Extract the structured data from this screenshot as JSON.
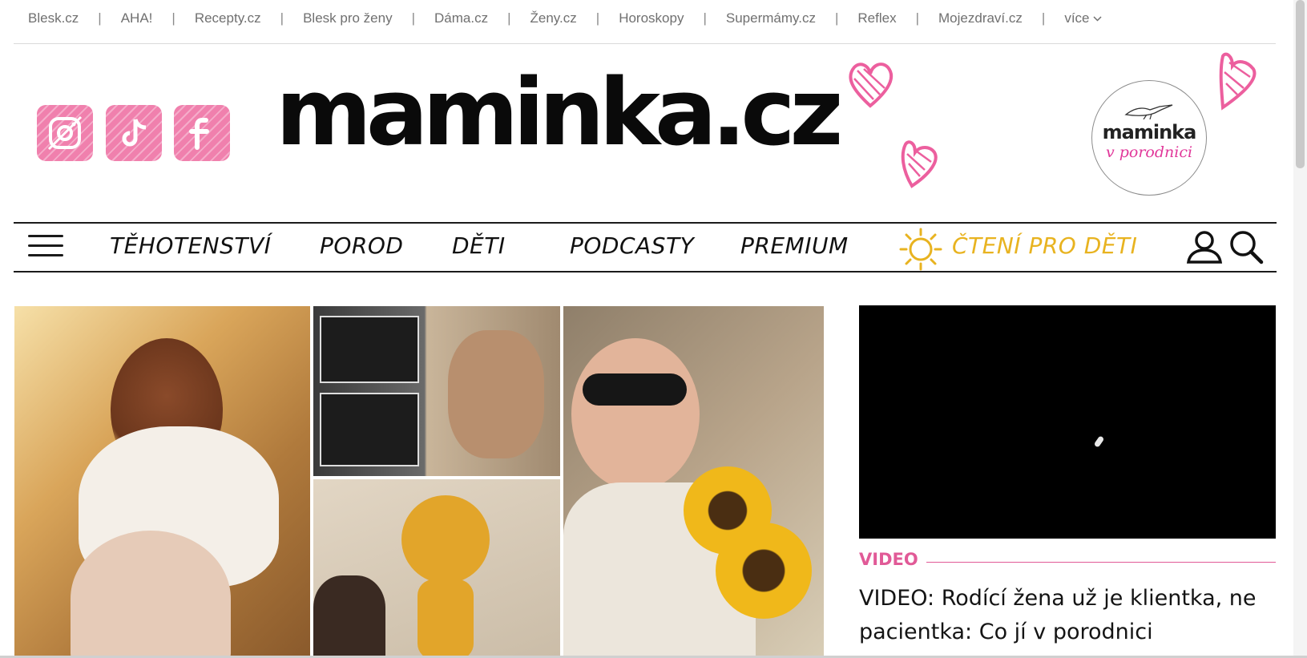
{
  "topnav": {
    "links": [
      "Blesk.cz",
      "AHA!",
      "Recepty.cz",
      "Blesk pro ženy",
      "Dáma.cz",
      "Ženy.cz",
      "Horoskopy",
      "Supermámy.cz",
      "Reflex",
      "Mojezdraví.cz"
    ],
    "more_label": "více",
    "separator": "|"
  },
  "social": [
    {
      "icon": "instagram-icon"
    },
    {
      "icon": "tiktok-icon"
    },
    {
      "icon": "facebook-icon"
    }
  ],
  "logo": {
    "text": "maminka.cz"
  },
  "badge": {
    "line1": "maminka",
    "line2": "v porodnici"
  },
  "mainnav": {
    "items": [
      "TĚHOTENSTVÍ",
      "POROD",
      "DĚTI",
      "PODCASTY",
      "PREMIUM"
    ],
    "kids_item": "ČTENÍ PRO DĚTI"
  },
  "video": {
    "label": "VIDEO",
    "title": "VIDEO: Rodící žena už je klientka, ne pacientka: Co jí v porodnici"
  },
  "colors": {
    "brand_pink": "#f080ad",
    "accent_pink": "#e15a97",
    "kids_yellow": "#e8b320",
    "text_dark": "#111111",
    "nav_gray": "#707070"
  }
}
